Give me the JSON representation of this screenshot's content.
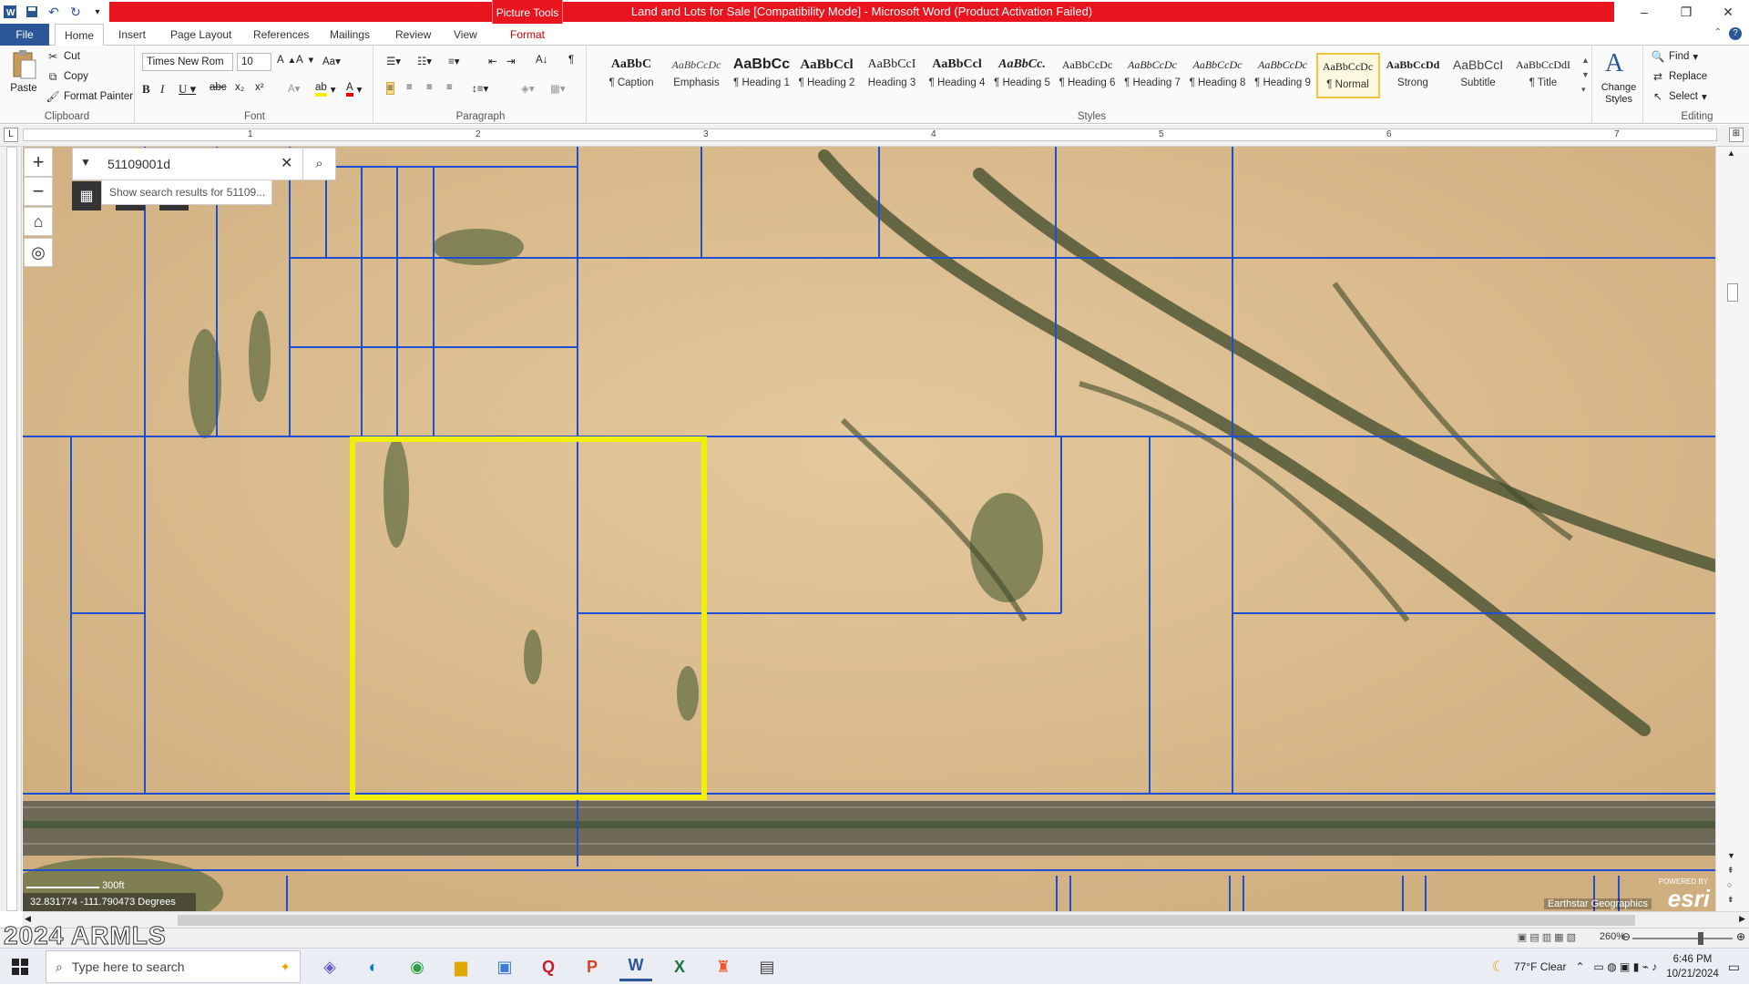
{
  "window": {
    "title": "Land and Lots for Sale [Compatibility Mode] - Microsoft Word (Product Activation Failed)",
    "context_tab": "Picture Tools"
  },
  "tabs": [
    "File",
    "Home",
    "Insert",
    "Page Layout",
    "References",
    "Mailings",
    "Review",
    "View",
    "Format"
  ],
  "clipboard": {
    "paste": "Paste",
    "cut": "Cut",
    "copy": "Copy",
    "format_painter": "Format Painter",
    "label": "Clipboard"
  },
  "font": {
    "name": "Times New Rom",
    "size": "10",
    "label": "Font"
  },
  "paragraph": {
    "label": "Paragraph"
  },
  "styles": {
    "label": "Styles",
    "items": [
      {
        "sample": "AaBbC",
        "name": "¶ Caption"
      },
      {
        "sample": "AaBbCcDc",
        "name": "Emphasis"
      },
      {
        "sample": "AaBbCc",
        "name": "¶ Heading 1"
      },
      {
        "sample": "AaBbCcl",
        "name": "¶ Heading 2"
      },
      {
        "sample": "AaBbCcI",
        "name": "Heading 3"
      },
      {
        "sample": "AaBbCcl",
        "name": "¶ Heading 4"
      },
      {
        "sample": "AaBbCc.",
        "name": "¶ Heading 5"
      },
      {
        "sample": "AaBbCcDc",
        "name": "¶ Heading 6"
      },
      {
        "sample": "AaBbCcDc",
        "name": "¶ Heading 7"
      },
      {
        "sample": "AaBbCcDc",
        "name": "¶ Heading 8"
      },
      {
        "sample": "AaBbCcDc",
        "name": "¶ Heading 9"
      },
      {
        "sample": "AaBbCcDc",
        "name": "¶ Normal"
      },
      {
        "sample": "AaBbCcDd",
        "name": "Strong"
      },
      {
        "sample": "AaBbCcI",
        "name": "Subtitle"
      },
      {
        "sample": "AaBbCcDdI",
        "name": "¶ Title"
      }
    ],
    "change_styles": "Change Styles"
  },
  "editing": {
    "find": "Find",
    "replace": "Replace",
    "select": "Select",
    "label": "Editing"
  },
  "ruler": {
    "marks": [
      "1",
      "2",
      "3",
      "4",
      "5",
      "6",
      "7"
    ]
  },
  "map": {
    "search_value": "51109001d",
    "search_hint": "Show search results for 51109...",
    "coordinates": "32.831774 -111.790473 Degrees",
    "scale": "300ft",
    "credit": "Earthstar Geographics",
    "powered_by": "POWERED BY",
    "logo": "esri",
    "zoom_in": "+",
    "zoom_out": "−"
  },
  "status": {
    "watermark": "2024 ARMLS",
    "zoom": "260%"
  },
  "taskbar": {
    "search_placeholder": "Type here to search",
    "weather": "77°F  Clear",
    "time": "6:46 PM",
    "date": "10/21/2024"
  },
  "colors": {
    "highlight": "#f0f000",
    "parcel_lines": "#1f4fd0",
    "title_bar": "#e8141e"
  }
}
